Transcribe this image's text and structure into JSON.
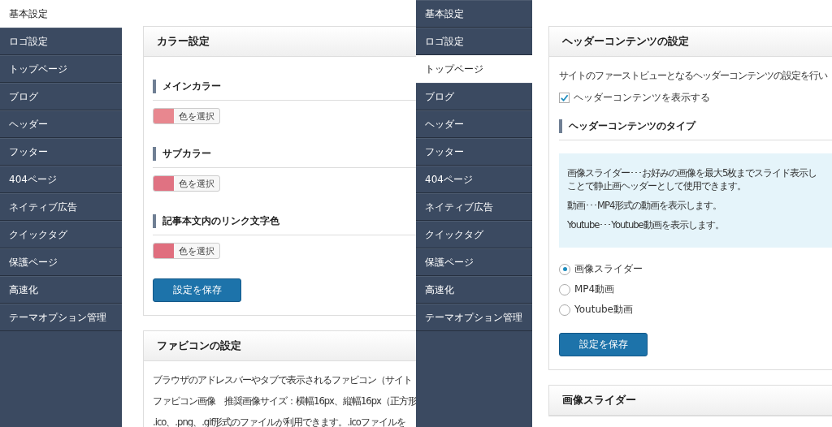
{
  "panels": [
    {
      "sidebar": [
        {
          "label": "基本設定",
          "selected": true
        },
        {
          "label": "ロゴ設定",
          "selected": false
        },
        {
          "label": "トップページ",
          "selected": false
        },
        {
          "label": "ブログ",
          "selected": false
        },
        {
          "label": "ヘッダー",
          "selected": false
        },
        {
          "label": "フッター",
          "selected": false
        },
        {
          "label": "404ページ",
          "selected": false
        },
        {
          "label": "ネイティブ広告",
          "selected": false
        },
        {
          "label": "クイックタグ",
          "selected": false
        },
        {
          "label": "保護ページ",
          "selected": false
        },
        {
          "label": "高速化",
          "selected": false
        },
        {
          "label": "テーマオプション管理",
          "selected": false
        }
      ],
      "cards": [
        {
          "title": "カラー設定",
          "blocks": [
            {
              "kind": "heading",
              "text": "メインカラー"
            },
            {
              "kind": "color",
              "color": "#e8878f",
              "button": "色を選択"
            },
            {
              "kind": "heading",
              "text": "サブカラー"
            },
            {
              "kind": "color",
              "color": "#e07282",
              "button": "色を選択"
            },
            {
              "kind": "heading",
              "text": "記事本文内のリンク文字色"
            },
            {
              "kind": "color",
              "color": "#e06e7e",
              "button": "色を選択"
            },
            {
              "kind": "button",
              "label": "設定を保存"
            }
          ]
        },
        {
          "title": "ファビコンの設定",
          "blocks": [
            {
              "kind": "text",
              "text": "ブラウザのアドレスバーやタブで表示されるファビコン（サイト"
            },
            {
              "kind": "text",
              "text": "ファビコン画像　推奨画像サイズ：横幅16px、縦幅16px（正方形"
            },
            {
              "kind": "text",
              "text": ".ico、.png、.gif形式のファイルが利用できます。.icoファイルを"
            }
          ]
        }
      ]
    },
    {
      "sidebar": [
        {
          "label": "基本設定",
          "selected": false
        },
        {
          "label": "ロゴ設定",
          "selected": false
        },
        {
          "label": "トップページ",
          "selected": true
        },
        {
          "label": "ブログ",
          "selected": false
        },
        {
          "label": "ヘッダー",
          "selected": false
        },
        {
          "label": "フッター",
          "selected": false
        },
        {
          "label": "404ページ",
          "selected": false
        },
        {
          "label": "ネイティブ広告",
          "selected": false
        },
        {
          "label": "クイックタグ",
          "selected": false
        },
        {
          "label": "保護ページ",
          "selected": false
        },
        {
          "label": "高速化",
          "selected": false
        },
        {
          "label": "テーマオプション管理",
          "selected": false
        }
      ],
      "cards": [
        {
          "title": "ヘッダーコンテンツの設定",
          "blocks": [
            {
              "kind": "text",
              "text": "サイトのファーストビューとなるヘッダーコンテンツの設定を行い"
            },
            {
              "kind": "checkbox",
              "label": "ヘッダーコンテンツを表示する",
              "checked": true
            },
            {
              "kind": "heading",
              "text": "ヘッダーコンテンツのタイプ"
            },
            {
              "kind": "info",
              "paragraphs": [
                [
                  "画像スライダー･･･お好みの画像を最大5枚までスライド表示し",
                  "ことで静止画ヘッダーとして使用できます。"
                ],
                [
                  "動画･･･MP4形式の動画を表示します。"
                ],
                [
                  "Youtube･･･Youtube動画を表示します。"
                ]
              ]
            },
            {
              "kind": "radio",
              "options": [
                {
                  "label": "画像スライダー",
                  "selected": true
                },
                {
                  "label": "MP4動画",
                  "selected": false
                },
                {
                  "label": "Youtube動画",
                  "selected": false
                }
              ]
            },
            {
              "kind": "button",
              "label": "設定を保存"
            }
          ]
        },
        {
          "title": "画像スライダー"
        }
      ]
    }
  ]
}
